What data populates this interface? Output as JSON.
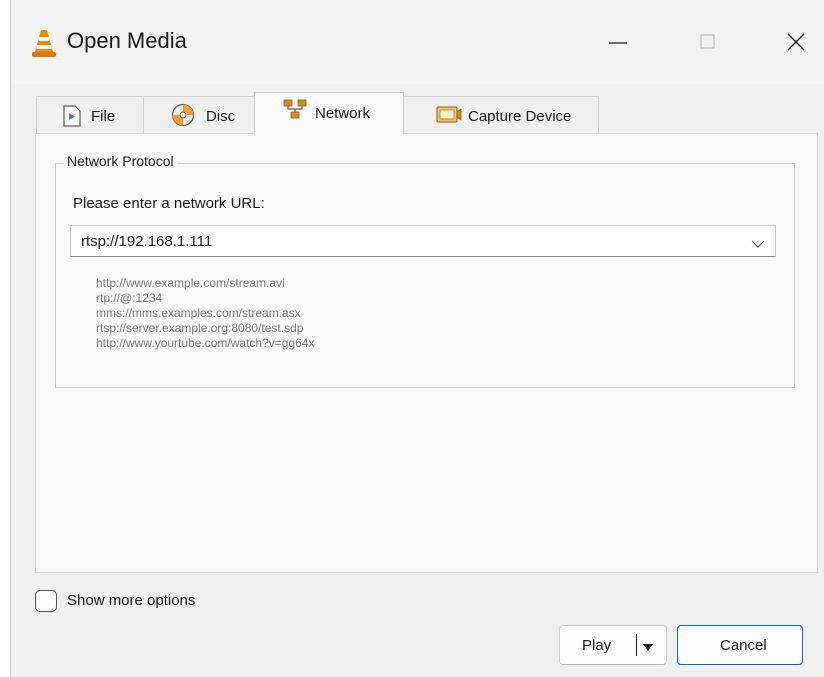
{
  "window": {
    "title": "Open Media",
    "icon": "vlc-cone-icon",
    "controls": {
      "minimize": "minimize-icon",
      "maximize": "maximize-icon",
      "close": "close-icon"
    }
  },
  "tabs": [
    {
      "label": "File",
      "icon": "file-play-icon"
    },
    {
      "label": "Disc",
      "icon": "disc-icon"
    },
    {
      "label": "Network",
      "icon": "network-icon",
      "selected": true
    },
    {
      "label": "Capture Device",
      "icon": "capture-device-icon"
    }
  ],
  "network": {
    "group_title": "Network Protocol",
    "url_label": "Please enter a network URL:",
    "url_value": "rtsp://192.168.1.111",
    "examples": [
      "http://www.example.com/stream.avi",
      "rtp://@:1234",
      "mms://mms.examples.com/stream.asx",
      "rtsp://server.example.org:8080/test.sdp",
      "http://www.yourtube.com/watch?v=gg64x"
    ]
  },
  "options": {
    "show_more_label": "Show more options",
    "show_more_checked": false
  },
  "buttons": {
    "play": "Play",
    "cancel": "Cancel"
  },
  "colors": {
    "accent": "#0067c0",
    "vlc_orange": "#f08a00"
  }
}
